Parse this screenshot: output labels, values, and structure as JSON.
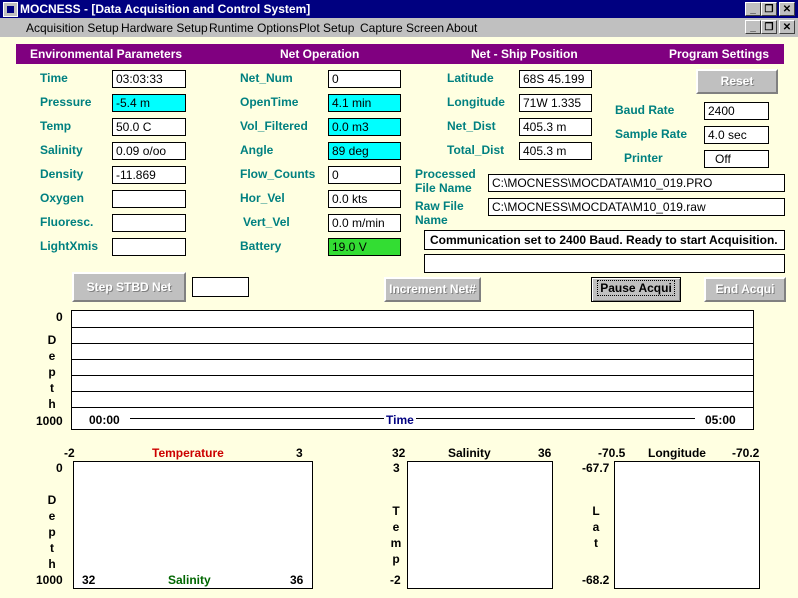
{
  "window": {
    "title": "MOCNESS - [Data Acquisition and Control System]"
  },
  "menu": [
    "Acquisition Setup",
    "Hardware Setup",
    "Runtime Options",
    "Plot Setup",
    "Capture Screen",
    "About"
  ],
  "sections": {
    "env": "Environmental Parameters",
    "net": "Net Operation",
    "ship": "Net - Ship Position",
    "prog": "Program Settings"
  },
  "env": [
    {
      "label": "Time",
      "value": "03:03:33",
      "hl": ""
    },
    {
      "label": "Pressure",
      "value": "-5.4 m",
      "hl": "cyan"
    },
    {
      "label": "Temp",
      "value": "50.0 C",
      "hl": ""
    },
    {
      "label": "Salinity",
      "value": "0.09 o/oo",
      "hl": ""
    },
    {
      "label": "Density",
      "value": "-11.869",
      "hl": ""
    },
    {
      "label": "Oxygen",
      "value": "",
      "hl": ""
    },
    {
      "label": "Fluoresc.",
      "value": "",
      "hl": ""
    },
    {
      "label": "LightXmis",
      "value": "",
      "hl": ""
    }
  ],
  "net": [
    {
      "label": "Net_Num",
      "value": "0",
      "hl": ""
    },
    {
      "label": "OpenTime",
      "value": "4.1 min",
      "hl": "cyan"
    },
    {
      "label": "Vol_Filtered",
      "value": "0.0 m3",
      "hl": "cyan"
    },
    {
      "label": "Angle",
      "value": "89 deg",
      "hl": "cyan"
    },
    {
      "label": "Flow_Counts",
      "value": "0",
      "hl": ""
    },
    {
      "label": "Hor_Vel",
      "value": "0.0 kts",
      "hl": ""
    },
    {
      "label": "Vert_Vel",
      "value": "0.0 m/min",
      "hl": ""
    },
    {
      "label": "Battery",
      "value": "19.0 V",
      "hl": "green"
    }
  ],
  "ship": [
    {
      "label": "Latitude",
      "value": "68S 45.199"
    },
    {
      "label": "Longitude",
      "value": "71W 1.335"
    },
    {
      "label": "Net_Dist",
      "value": "405.3 m"
    },
    {
      "label": "Total_Dist",
      "value": "405.3 m"
    }
  ],
  "prog": {
    "reset": "Reset",
    "baud_label": "Baud Rate",
    "baud": "2400",
    "sample_label": "Sample Rate",
    "sample": "4.0 sec",
    "printer_label": "Printer",
    "printer": "Off"
  },
  "files": {
    "processed_label1": "Processed",
    "processed_label2": "File Name",
    "processed": "C:\\MOCNESS\\MOCDATA\\M10_019.PRO",
    "raw_label1": "Raw File",
    "raw_label2": "Name",
    "raw": "C:\\MOCNESS\\MOCDATA\\M10_019.raw"
  },
  "status": {
    "message": "Communication set to 2400 Baud.  Ready to start Acquisition.",
    "message2": ""
  },
  "buttons": {
    "step": "Step STBD Net",
    "step_value": "",
    "increment": "Increment Net#",
    "pause": "Pause Acqui",
    "end": "End Acqui"
  },
  "depth_plot": {
    "top": "0",
    "bottom": "1000",
    "label": "Depth",
    "start": "00:00",
    "end": "05:00",
    "axis": "Time"
  },
  "temp_plot": {
    "xmin": "-2",
    "xmax": "3",
    "xlabel": "Temperature",
    "ytop": "0",
    "ybottom": "1000",
    "ylabel": "Depth",
    "bmin": "32",
    "bmax": "36",
    "blabel": "Salinity"
  },
  "ts_plot": {
    "xmin": "32",
    "xmax": "36",
    "xlabel": "Salinity",
    "ytop": "3",
    "ybottom": "-2",
    "ylabel": "Temp"
  },
  "pos_plot": {
    "xmin": "-70.5",
    "xmax": "-70.2",
    "xlabel": "Longitude",
    "ytop": "-67.7",
    "ybottom": "-68.2",
    "ylabel": "Lat"
  },
  "colors": {
    "title_bar": "#000080",
    "header": "#800080",
    "label": "#008080",
    "background": "#ffffe1",
    "highlight": "#00ffff",
    "battery": "#33dd33"
  }
}
